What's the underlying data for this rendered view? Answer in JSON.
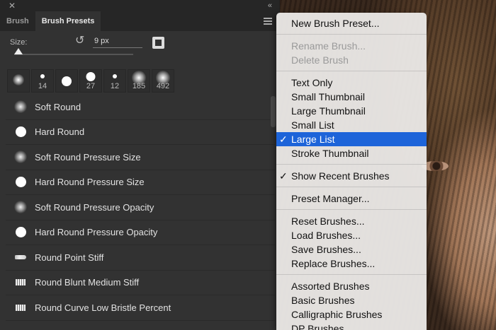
{
  "panel": {
    "tabs": [
      {
        "label": "Brush"
      },
      {
        "label": "Brush Presets"
      }
    ],
    "size_label": "Size:",
    "size_value": "9 px",
    "recents": [
      {
        "num": ""
      },
      {
        "num": "14"
      },
      {
        "num": ""
      },
      {
        "num": "27"
      },
      {
        "num": "12"
      },
      {
        "num": "185"
      },
      {
        "num": "492"
      }
    ],
    "presets": [
      {
        "label": "Soft Round",
        "icon": "soft-brush-icon"
      },
      {
        "label": "Hard Round",
        "icon": "hard-brush-icon"
      },
      {
        "label": "Soft Round Pressure Size",
        "icon": "soft-brush-icon"
      },
      {
        "label": "Hard Round Pressure Size",
        "icon": "hard-brush-icon"
      },
      {
        "label": "Soft Round Pressure Opacity",
        "icon": "soft-brush-icon"
      },
      {
        "label": "Hard Round Pressure Opacity",
        "icon": "hard-brush-icon"
      },
      {
        "label": "Round Point Stiff",
        "icon": "stiff-brush-icon"
      },
      {
        "label": "Round Blunt Medium Stiff",
        "icon": "blunt-brush-icon"
      },
      {
        "label": "Round Curve Low Bristle Percent",
        "icon": "blunt-brush-icon"
      }
    ]
  },
  "menu": {
    "group1": [
      "New Brush Preset..."
    ],
    "group2": [
      "Rename Brush...",
      "Delete Brush"
    ],
    "group3": [
      "Text Only",
      "Small Thumbnail",
      "Large Thumbnail",
      "Small List",
      "Large List",
      "Stroke Thumbnail"
    ],
    "group4": [
      "Show Recent Brushes"
    ],
    "group5": [
      "Preset Manager..."
    ],
    "group6": [
      "Reset Brushes...",
      "Load Brushes...",
      "Save Brushes...",
      "Replace Brushes..."
    ],
    "group7": [
      "Assorted Brushes",
      "Basic Brushes",
      "Calligraphic Brushes",
      "DP Brushes"
    ],
    "check": "✓"
  },
  "colors": {
    "highlight": "#1d64d9",
    "panel_bg": "#323232"
  }
}
